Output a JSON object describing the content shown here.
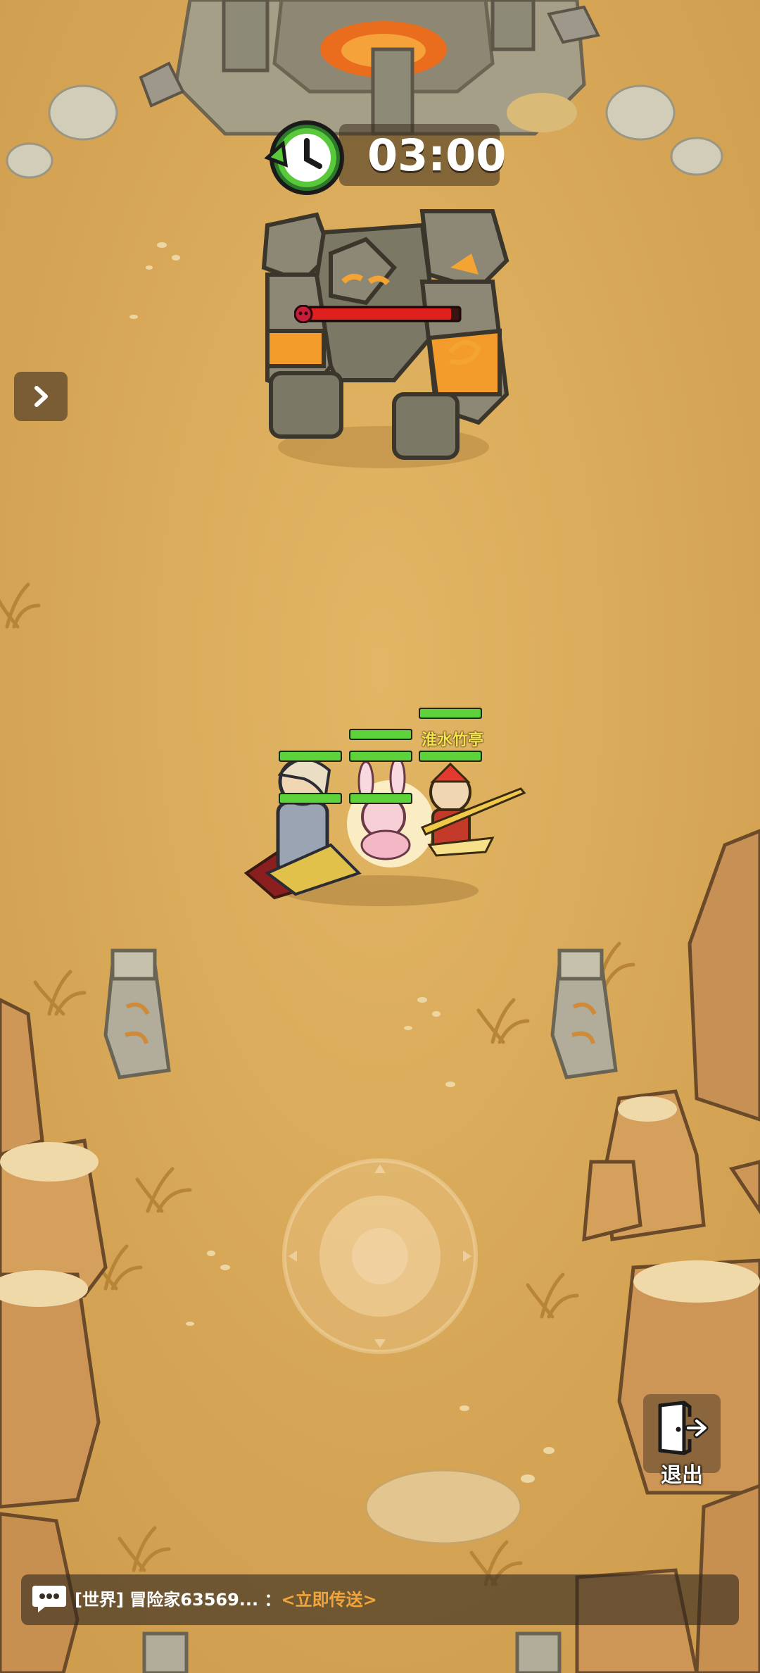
{
  "hud": {
    "timer": "03:00",
    "boss_hp_fraction": 0.95,
    "exit_label": "退出"
  },
  "party": {
    "hero_name": "淮水竹亭"
  },
  "chat": {
    "channel": "[世界]",
    "sender": "冒险家63569...",
    "separator": "：",
    "link": "<立即传送>"
  },
  "icons": [
    "timer-icon",
    "chevron-right-icon",
    "exit-door-icon",
    "chat-bubble-icon",
    "demon-skull-icon"
  ]
}
